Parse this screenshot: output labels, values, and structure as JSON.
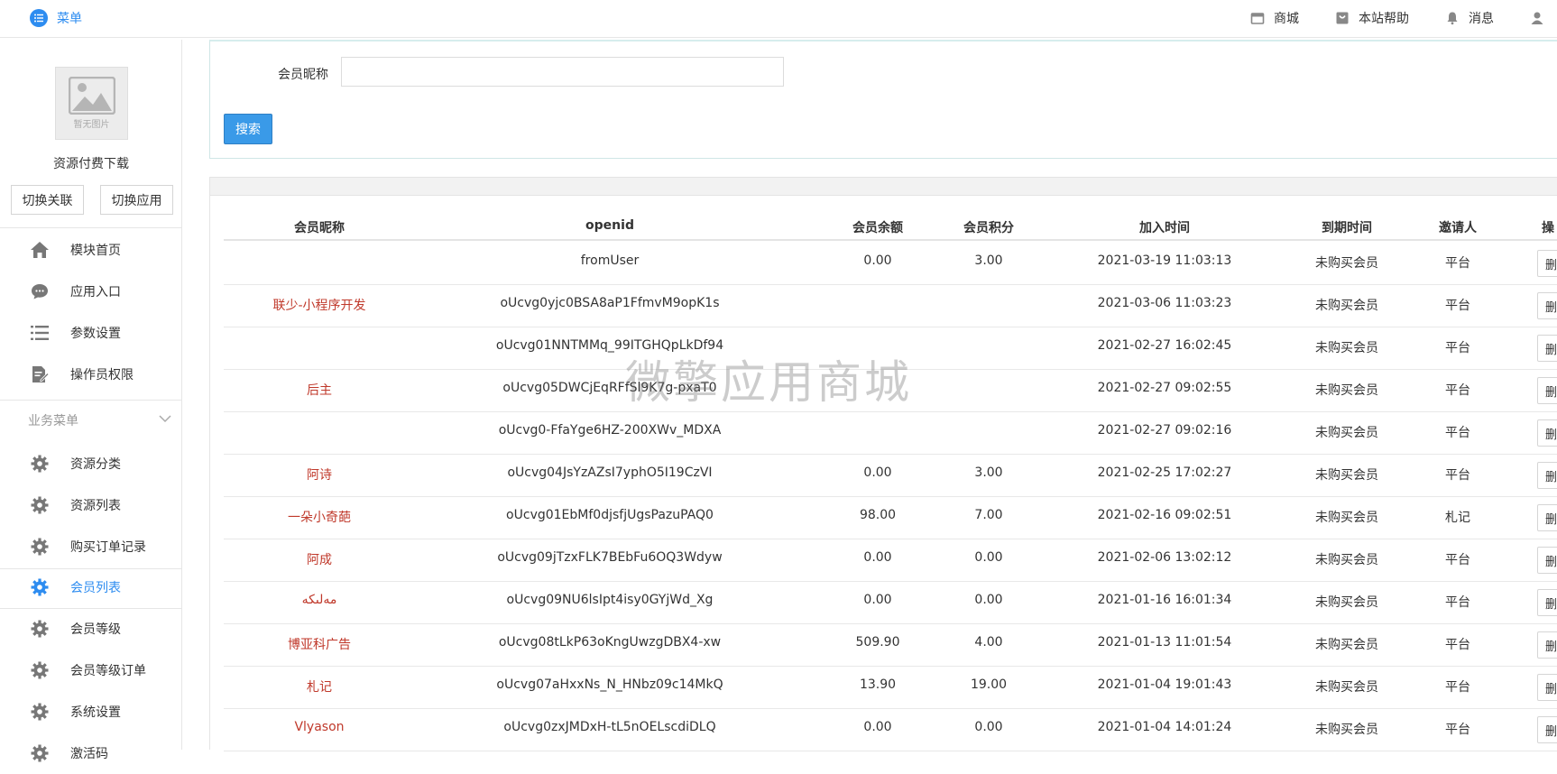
{
  "topbar": {
    "menu_label": "菜单",
    "links": [
      {
        "label": "商城",
        "icon": "shop-icon"
      },
      {
        "label": "本站帮助",
        "icon": "help-bag-icon"
      },
      {
        "label": "消息",
        "icon": "bell-icon"
      }
    ]
  },
  "sidebar": {
    "avatar_text": "暂无图片",
    "app_name": "资源付费下载",
    "switch_link_label": "切换关联",
    "switch_app_label": "切换应用",
    "top_items": [
      {
        "label": "模块首页",
        "icon": "home-icon"
      },
      {
        "label": "应用入口",
        "icon": "chat-icon"
      },
      {
        "label": "参数设置",
        "icon": "list-icon"
      },
      {
        "label": "操作员权限",
        "icon": "edit-doc-icon"
      }
    ],
    "group_title": "业务菜单",
    "group_items": [
      {
        "label": "资源分类",
        "icon": "gear-icon",
        "active": false
      },
      {
        "label": "资源列表",
        "icon": "gear-icon",
        "active": false
      },
      {
        "label": "购买订单记录",
        "icon": "gear-icon",
        "active": false
      },
      {
        "label": "会员列表",
        "icon": "gear-icon",
        "active": true
      },
      {
        "label": "会员等级",
        "icon": "gear-icon",
        "active": false
      },
      {
        "label": "会员等级订单",
        "icon": "gear-icon",
        "active": false
      },
      {
        "label": "系统设置",
        "icon": "gear-icon",
        "active": false
      },
      {
        "label": "激活码",
        "icon": "gear-icon",
        "active": false
      }
    ]
  },
  "search": {
    "label": "会员昵称",
    "value": "",
    "placeholder": "",
    "button_label": "搜索"
  },
  "table": {
    "columns": [
      "会员昵称",
      "openid",
      "会员余额",
      "会员积分",
      "加入时间",
      "到期时间",
      "邀请人",
      "操"
    ],
    "action_label": "删",
    "rows": [
      {
        "nick": "",
        "openid": "fromUser",
        "balance": "0.00",
        "points": "3.00",
        "joined": "2021-03-19 11:03:13",
        "expire": "未购买会员",
        "inviter": "平台"
      },
      {
        "nick": "联少-小程序开发",
        "openid": "oUcvg0yjc0BSA8aP1FfmvM9opK1s",
        "balance": "",
        "points": "",
        "joined": "2021-03-06 11:03:23",
        "expire": "未购买会员",
        "inviter": "平台"
      },
      {
        "nick": "",
        "openid": "oUcvg01NNTMMq_99ITGHQpLkDf94",
        "balance": "",
        "points": "",
        "joined": "2021-02-27 16:02:45",
        "expire": "未购买会员",
        "inviter": "平台"
      },
      {
        "nick": "后主",
        "openid": "oUcvg05DWCjEqRFfSl9K7g-pxaT0",
        "balance": "",
        "points": "",
        "joined": "2021-02-27 09:02:55",
        "expire": "未购买会员",
        "inviter": "平台"
      },
      {
        "nick": "",
        "openid": "oUcvg0-FfaYge6HZ-200XWv_MDXA",
        "balance": "",
        "points": "",
        "joined": "2021-02-27 09:02:16",
        "expire": "未购买会员",
        "inviter": "平台"
      },
      {
        "nick": "阿诗",
        "openid": "oUcvg04JsYzAZsI7yphO5I19CzVI",
        "balance": "0.00",
        "points": "3.00",
        "joined": "2021-02-25 17:02:27",
        "expire": "未购买会员",
        "inviter": "平台"
      },
      {
        "nick": "一朵小奇葩",
        "openid": "oUcvg01EbMf0djsfjUgsPazuPAQ0",
        "balance": "98.00",
        "points": "7.00",
        "joined": "2021-02-16 09:02:51",
        "expire": "未购买会员",
        "inviter": "札记"
      },
      {
        "nick": "阿成",
        "openid": "oUcvg09jTzxFLK7BEbFu6OQ3Wdyw",
        "balance": "0.00",
        "points": "0.00",
        "joined": "2021-02-06 13:02:12",
        "expire": "未购买会员",
        "inviter": "平台"
      },
      {
        "nick": "مەلىكە",
        "openid": "oUcvg09NU6lsIpt4isy0GYjWd_Xg",
        "balance": "0.00",
        "points": "0.00",
        "joined": "2021-01-16 16:01:34",
        "expire": "未购买会员",
        "inviter": "平台"
      },
      {
        "nick": "博亚科广告",
        "openid": "oUcvg08tLkP63oKngUwzgDBX4-xw",
        "balance": "509.90",
        "points": "4.00",
        "joined": "2021-01-13 11:01:54",
        "expire": "未购买会员",
        "inviter": "平台"
      },
      {
        "nick": "札记",
        "openid": "oUcvg07aHxxNs_N_HNbz09c14MkQ",
        "balance": "13.90",
        "points": "19.00",
        "joined": "2021-01-04 19:01:43",
        "expire": "未购买会员",
        "inviter": "平台"
      },
      {
        "nick": "Vlyason",
        "openid": "oUcvg0zxJMDxH-tL5nOELscdiDLQ",
        "balance": "0.00",
        "points": "0.00",
        "joined": "2021-01-04 14:01:24",
        "expire": "未购买会员",
        "inviter": "平台"
      }
    ]
  },
  "watermark": "微擎应用商城"
}
